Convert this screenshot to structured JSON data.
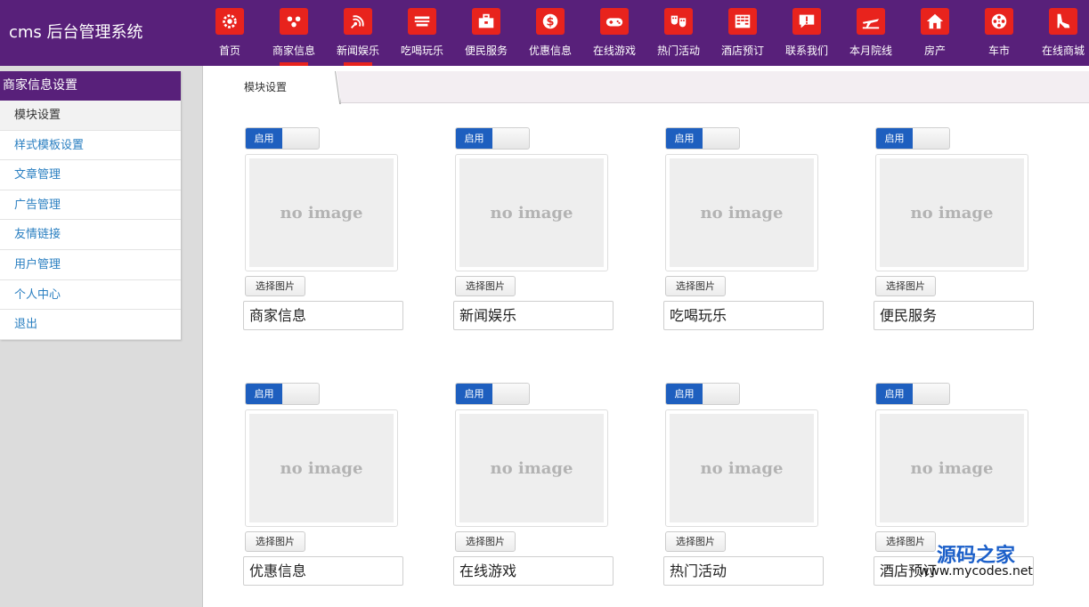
{
  "brand": "cms 后台管理系统",
  "nav": [
    {
      "label": "首页",
      "icon": "gear-icon"
    },
    {
      "label": "商家信息",
      "icon": "people-icon"
    },
    {
      "label": "新闻娱乐",
      "icon": "satellite-icon"
    },
    {
      "label": "吃喝玩乐",
      "icon": "food-icon"
    },
    {
      "label": "便民服务",
      "icon": "toolbox-icon"
    },
    {
      "label": "优惠信息",
      "icon": "dollar-icon"
    },
    {
      "label": "在线游戏",
      "icon": "gamepad-icon"
    },
    {
      "label": "热门活动",
      "icon": "masks-icon"
    },
    {
      "label": "酒店预订",
      "icon": "building-icon"
    },
    {
      "label": "联系我们",
      "icon": "message-icon"
    },
    {
      "label": "本月院线",
      "icon": "plane-icon"
    },
    {
      "label": "房产",
      "icon": "house-icon"
    },
    {
      "label": "车市",
      "icon": "film-reel-icon"
    },
    {
      "label": "在线商城",
      "icon": "shoe-icon"
    }
  ],
  "sidebar": {
    "title": "商家信息设置",
    "items": [
      {
        "label": "模块设置"
      },
      {
        "label": "样式模板设置"
      },
      {
        "label": "文章管理"
      },
      {
        "label": "广告管理"
      },
      {
        "label": "友情链接"
      },
      {
        "label": "用户管理"
      },
      {
        "label": "个人中心"
      },
      {
        "label": "退出"
      }
    ]
  },
  "tab": {
    "label": "模块设置"
  },
  "modules": [
    {
      "toggle": "启用",
      "image": "no image",
      "button": "选择图片",
      "name": "商家信息"
    },
    {
      "toggle": "启用",
      "image": "no image",
      "button": "选择图片",
      "name": "新闻娱乐"
    },
    {
      "toggle": "启用",
      "image": "no image",
      "button": "选择图片",
      "name": "吃喝玩乐"
    },
    {
      "toggle": "启用",
      "image": "no image",
      "button": "选择图片",
      "name": "便民服务"
    },
    {
      "toggle": "启用",
      "image": "no image",
      "button": "选择图片",
      "name": "优惠信息"
    },
    {
      "toggle": "启用",
      "image": "no image",
      "button": "选择图片",
      "name": "在线游戏"
    },
    {
      "toggle": "启用",
      "image": "no image",
      "button": "选择图片",
      "name": "热门活动"
    },
    {
      "toggle": "启用",
      "image": "no image",
      "button": "选择图片",
      "name": "酒店预订"
    }
  ],
  "watermark": {
    "big": "源码之家",
    "small": "www.mycodes.net"
  },
  "colors": {
    "header": "#58207a",
    "accent": "#e8231d",
    "toggle": "#1e5fbf"
  }
}
